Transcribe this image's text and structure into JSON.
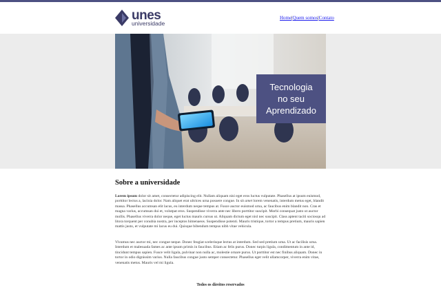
{
  "brand": {
    "name": "unes",
    "subtitle": "universidade",
    "accent_color": "#4d5182"
  },
  "nav": {
    "items": [
      {
        "label": "Home"
      },
      {
        "label": "Quem somos"
      },
      {
        "label": "Contato"
      }
    ],
    "separator": "|"
  },
  "hero": {
    "banner_line1": "Tecnologia",
    "banner_line2": "no seu",
    "banner_line3": "Aprendizado"
  },
  "about": {
    "title": "Sobre a universidade",
    "p1_strong": "Lorem ipsum",
    "p1_text": " dolor sit amet, consectetur adipiscing elit. Nullam aliquam nisi eget eros luctus vulputate. Phasellus at ipsum euismod, porttitor lectus a, lacinia dolor. Nam aliquet erat ultrices urna posuere congue. In sit ",
    "p1_em": "amet",
    "p1_text2": " lorem venenatis, interdum metus eget, blandit massa. Phasellus accumsan elit lacus, eu interdum neque tempus at. Fusce auctor euismod urna, ac faucibus enim blandit non. Cras et magna varius, accumsan dui et, volutpat eros. Suspendisse viverra ante nec libero porttitor suscipit. Morbi consequat justo ut auctor mollis. Phasellus viverra dolor neque, eget luctus mauris cursus ut. Aliquam dictum eget nisl nec suscipit. Class aptent taciti sociosqu ad litora torquent per conubia nostra, per inceptos himenaeos. Suspendisse potenti. Mauris tristique, tortor a tempus pretium, mauris sapien mattis justo, et vulputate mi lacus eu dui. Quisque bibendum tempus nibh vitae vehicula.",
    "p2": "Vivamus nec auctor mi, nec congue neque. Donec feugiat scelerisque lectus at interdum. Sed sed pretium urna. Ut ac facilisis urna. Interdum et malesuada fames ac ante ipsum primis in faucibus. Etiam ac felis purus. Donec turpis ligula, condimentum in ante id, tincidunt tempus sapien. Fusce velit ligula, pulvinar non nulla ac, molestie ornare purus. Ut porttitor est nec finibus aliquam. Donec in tortor in odio dignissim varius. Nulla faucibus congue justo semper consectetur. Phasellus eget velit ullamcorper, viverra enim vitae, venenatis metus. Mauris vel mi ligula."
  },
  "footer": {
    "text": "Todos os direitos reservados"
  }
}
